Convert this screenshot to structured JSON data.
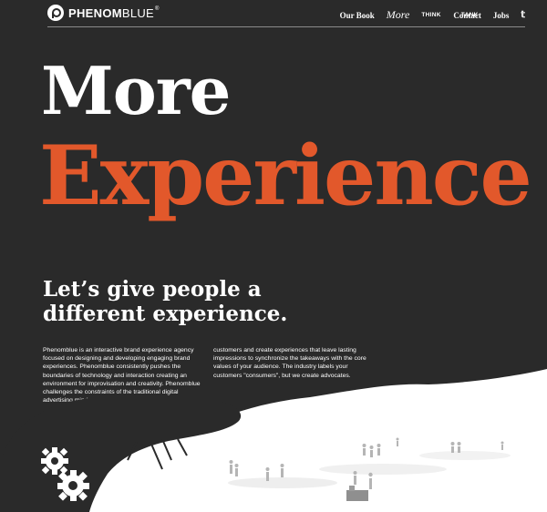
{
  "brand": {
    "name_part1": "PHENOM",
    "name_part2": "BLUE",
    "registered": "®"
  },
  "nav": {
    "items": [
      {
        "label": "Our Book",
        "style": "serif"
      },
      {
        "label": "More",
        "style": "script"
      },
      {
        "label": "THINK TANK",
        "style": "stacked"
      },
      {
        "label": "Contact",
        "style": "serif"
      },
      {
        "label": "Jobs",
        "style": "serif"
      }
    ],
    "twitter_icon": "twitter-icon"
  },
  "hero": {
    "line1": "More",
    "line2": "Experience"
  },
  "tagline": "Let’s give people a different experience.",
  "body": {
    "col1": "Phenomblue is an interactive brand experience agency focused on designing and developing engaging brand experiences. Phenomblue consistently pushes the boundaries of technology and interaction creating an environment for improvisation and creativity. Phenomblue challenges the constraints of the traditional digital advertising mindset. We make deeper connections with",
    "col2": "customers and create experiences that leave lasting impressions to synchronize the takeaways with the core values of your audience. The industry labels your customers \"consumers\", but we create advocates."
  },
  "colors": {
    "background": "#2a2a2a",
    "accent": "#e2582b",
    "text": "#ffffff"
  },
  "icons": [
    "logo-icon",
    "twitter-icon",
    "gears-icon"
  ]
}
